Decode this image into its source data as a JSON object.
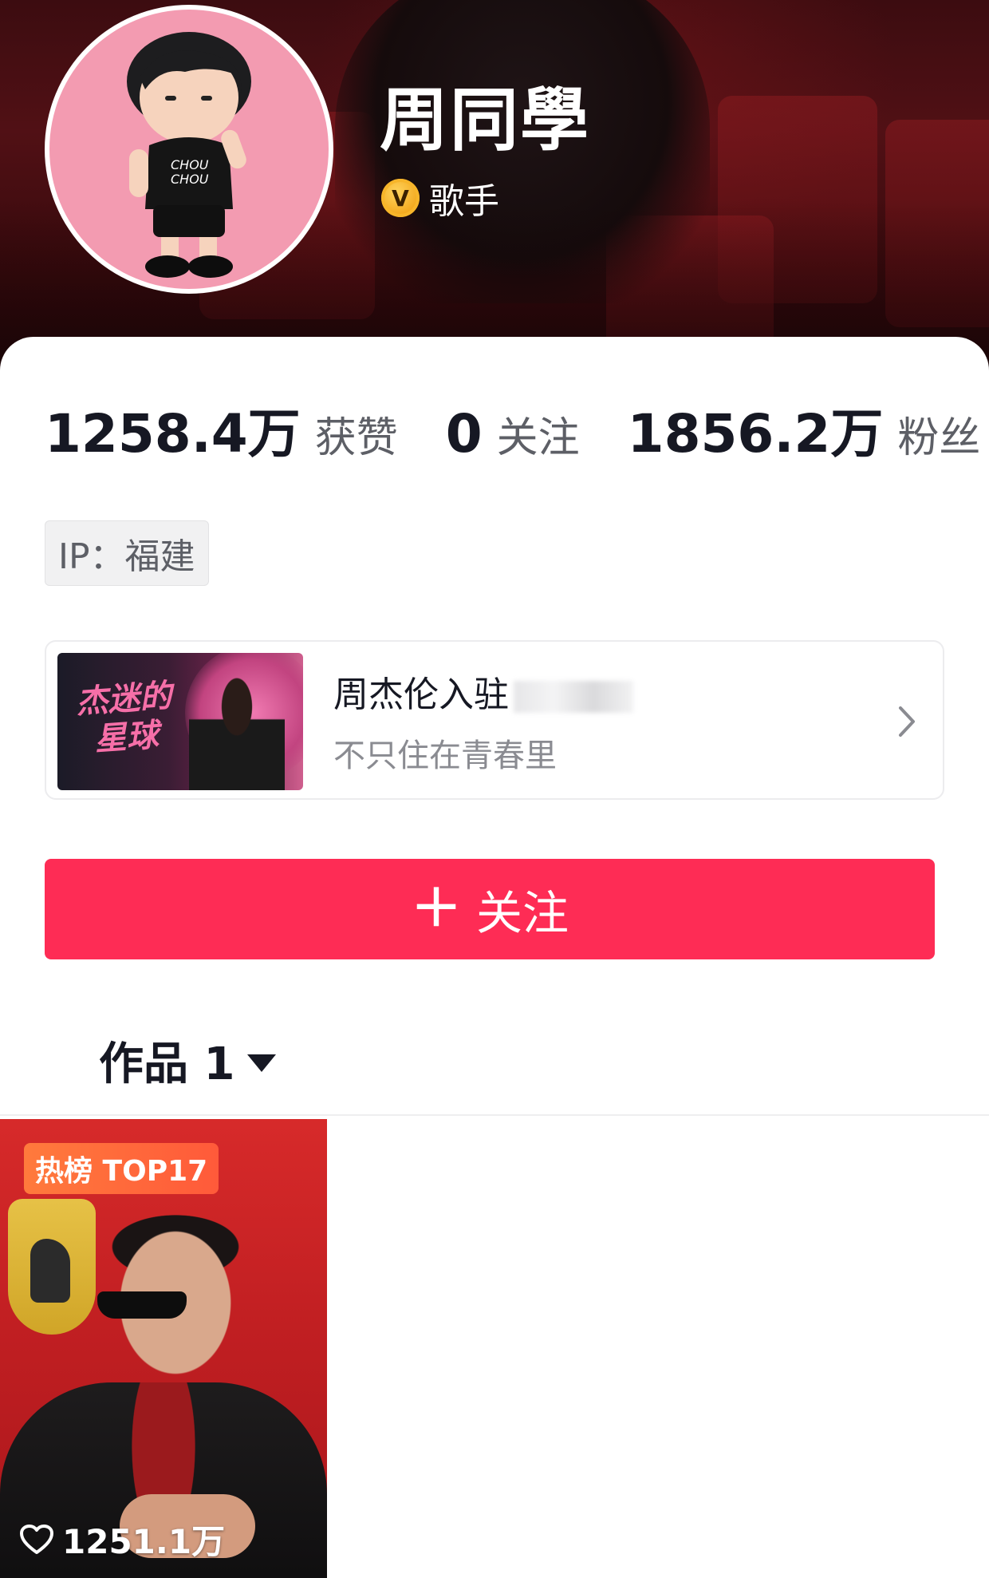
{
  "profile": {
    "display_name": "周同學",
    "verified_badge": "V",
    "role": "歌手"
  },
  "stats": {
    "likes_count": "1258.4万",
    "likes_label": "获赞",
    "following_count": "0",
    "following_label": "关注",
    "followers_count": "1856.2万",
    "followers_label": "粉丝"
  },
  "ip_location": "IP：福建",
  "promo": {
    "thumb_text": "杰迷的星球",
    "title": "周杰伦入驻",
    "subtitle": "不只住在青春里"
  },
  "follow_button": {
    "label": "关注",
    "color": "#fe2c55"
  },
  "works_tab": {
    "label": "作品 1"
  },
  "videos": [
    {
      "badge": "热榜 TOP17",
      "likes": "1251.1万"
    }
  ],
  "icons": {
    "verified": "verified-v-icon",
    "chevron": "chevron-right-icon",
    "plus": "plus-icon",
    "dropdown": "triangle-down-icon",
    "like": "heart-outline-icon"
  }
}
